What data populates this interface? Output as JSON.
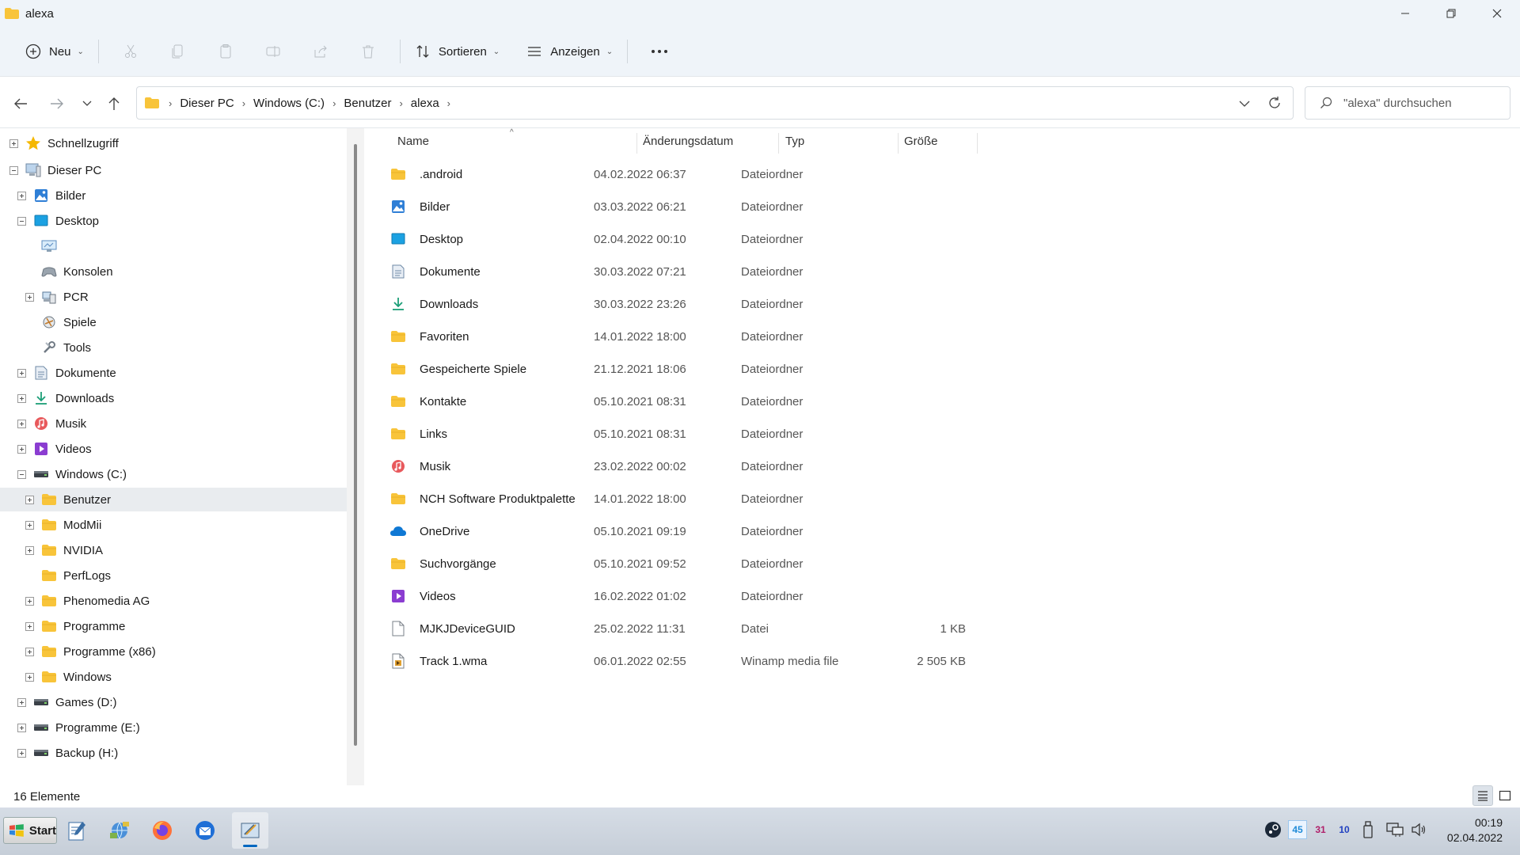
{
  "window": {
    "title": "alexa"
  },
  "commandbar": {
    "new_label": "Neu",
    "sort_label": "Sortieren",
    "view_label": "Anzeigen"
  },
  "address": {
    "crumbs": [
      "Dieser PC",
      "Windows (C:)",
      "Benutzer",
      "alexa"
    ]
  },
  "search": {
    "placeholder": "\"alexa\" durchsuchen"
  },
  "tree": [
    {
      "label": "Schnellzugriff",
      "icon": "star-icon",
      "level": 0,
      "expander": "plus",
      "top": 0
    },
    {
      "label": "Dieser PC",
      "icon": "computer-icon",
      "level": 0,
      "expander": "minus"
    },
    {
      "label": "Bilder",
      "icon": "pictures-icon",
      "level": 1,
      "expander": "plus"
    },
    {
      "label": "Desktop",
      "icon": "desktop-icon",
      "level": 1,
      "expander": "minus"
    },
    {
      "label": "",
      "icon": "monitor-icon",
      "level": 2,
      "expander": "none"
    },
    {
      "label": "Konsolen",
      "icon": "controller-icon",
      "level": 2,
      "expander": "none"
    },
    {
      "label": "PCR",
      "icon": "pcr-icon",
      "level": 2,
      "expander": "plus"
    },
    {
      "label": "Spiele",
      "icon": "games-icon",
      "level": 2,
      "expander": "none"
    },
    {
      "label": "Tools",
      "icon": "tools-icon",
      "level": 2,
      "expander": "none"
    },
    {
      "label": "Dokumente",
      "icon": "documents-icon",
      "level": 1,
      "expander": "plus"
    },
    {
      "label": "Downloads",
      "icon": "download-icon",
      "level": 1,
      "expander": "plus"
    },
    {
      "label": "Musik",
      "icon": "music-icon",
      "level": 1,
      "expander": "plus"
    },
    {
      "label": "Videos",
      "icon": "videos-icon",
      "level": 1,
      "expander": "plus"
    },
    {
      "label": "Windows (C:)",
      "icon": "drive-icon",
      "level": 1,
      "expander": "minus"
    },
    {
      "label": "Benutzer",
      "icon": "folder-icon",
      "level": 2,
      "expander": "plus",
      "selected": true
    },
    {
      "label": "ModMii",
      "icon": "folder-icon",
      "level": 2,
      "expander": "plus"
    },
    {
      "label": "NVIDIA",
      "icon": "folder-icon",
      "level": 2,
      "expander": "plus"
    },
    {
      "label": "PerfLogs",
      "icon": "folder-icon",
      "level": 2,
      "expander": "none"
    },
    {
      "label": "Phenomedia AG",
      "icon": "folder-icon",
      "level": 2,
      "expander": "plus"
    },
    {
      "label": "Programme",
      "icon": "folder-icon",
      "level": 2,
      "expander": "plus"
    },
    {
      "label": "Programme (x86)",
      "icon": "folder-icon",
      "level": 2,
      "expander": "plus"
    },
    {
      "label": "Windows",
      "icon": "folder-icon",
      "level": 2,
      "expander": "plus"
    },
    {
      "label": "Games (D:)",
      "icon": "drive-icon",
      "level": 1,
      "expander": "plus"
    },
    {
      "label": "Programme (E:)",
      "icon": "drive-icon",
      "level": 1,
      "expander": "plus"
    },
    {
      "label": "Backup (H:)",
      "icon": "drive-icon",
      "level": 1,
      "expander": "plus"
    }
  ],
  "columns": {
    "name": "Name",
    "date": "Änderungsdatum",
    "type": "Typ",
    "size": "Größe"
  },
  "files": [
    {
      "name": ".android",
      "date": "04.02.2022 06:37",
      "type": "Dateiordner",
      "size": "",
      "icon": "folder-icon"
    },
    {
      "name": "Bilder",
      "date": "03.03.2022 06:21",
      "type": "Dateiordner",
      "size": "",
      "icon": "pictures-icon"
    },
    {
      "name": "Desktop",
      "date": "02.04.2022 00:10",
      "type": "Dateiordner",
      "size": "",
      "icon": "desktop-icon"
    },
    {
      "name": "Dokumente",
      "date": "30.03.2022 07:21",
      "type": "Dateiordner",
      "size": "",
      "icon": "documents-icon"
    },
    {
      "name": "Downloads",
      "date": "30.03.2022 23:26",
      "type": "Dateiordner",
      "size": "",
      "icon": "download-icon"
    },
    {
      "name": "Favoriten",
      "date": "14.01.2022 18:00",
      "type": "Dateiordner",
      "size": "",
      "icon": "folder-icon"
    },
    {
      "name": "Gespeicherte Spiele",
      "date": "21.12.2021 18:06",
      "type": "Dateiordner",
      "size": "",
      "icon": "folder-icon"
    },
    {
      "name": "Kontakte",
      "date": "05.10.2021 08:31",
      "type": "Dateiordner",
      "size": "",
      "icon": "folder-icon"
    },
    {
      "name": "Links",
      "date": "05.10.2021 08:31",
      "type": "Dateiordner",
      "size": "",
      "icon": "folder-icon"
    },
    {
      "name": "Musik",
      "date": "23.02.2022 00:02",
      "type": "Dateiordner",
      "size": "",
      "icon": "music-icon"
    },
    {
      "name": "NCH Software Produktpalette",
      "date": "14.01.2022 18:00",
      "type": "Dateiordner",
      "size": "",
      "icon": "folder-icon"
    },
    {
      "name": "OneDrive",
      "date": "05.10.2021 09:19",
      "type": "Dateiordner",
      "size": "",
      "icon": "cloud-icon"
    },
    {
      "name": "Suchvorgänge",
      "date": "05.10.2021 09:52",
      "type": "Dateiordner",
      "size": "",
      "icon": "folder-icon"
    },
    {
      "name": "Videos",
      "date": "16.02.2022 01:02",
      "type": "Dateiordner",
      "size": "",
      "icon": "videos-icon"
    },
    {
      "name": "MJKJDeviceGUID",
      "date": "25.02.2022 11:31",
      "type": "Datei",
      "size": "1 KB",
      "icon": "file-icon"
    },
    {
      "name": "Track 1.wma",
      "date": "06.01.2022 02:55",
      "type": "Winamp media file",
      "size": "2 505 KB",
      "icon": "media-file-icon"
    }
  ],
  "status": {
    "count": "16 Elemente"
  },
  "taskbar": {
    "start_label": "Start",
    "tray_nums": [
      "45",
      "31",
      "10"
    ],
    "time": "00:19",
    "date": "02.04.2022"
  },
  "colors": {
    "folder": "#f8c43a",
    "accent": "#0067c0",
    "chrome": "#eff4f9"
  }
}
